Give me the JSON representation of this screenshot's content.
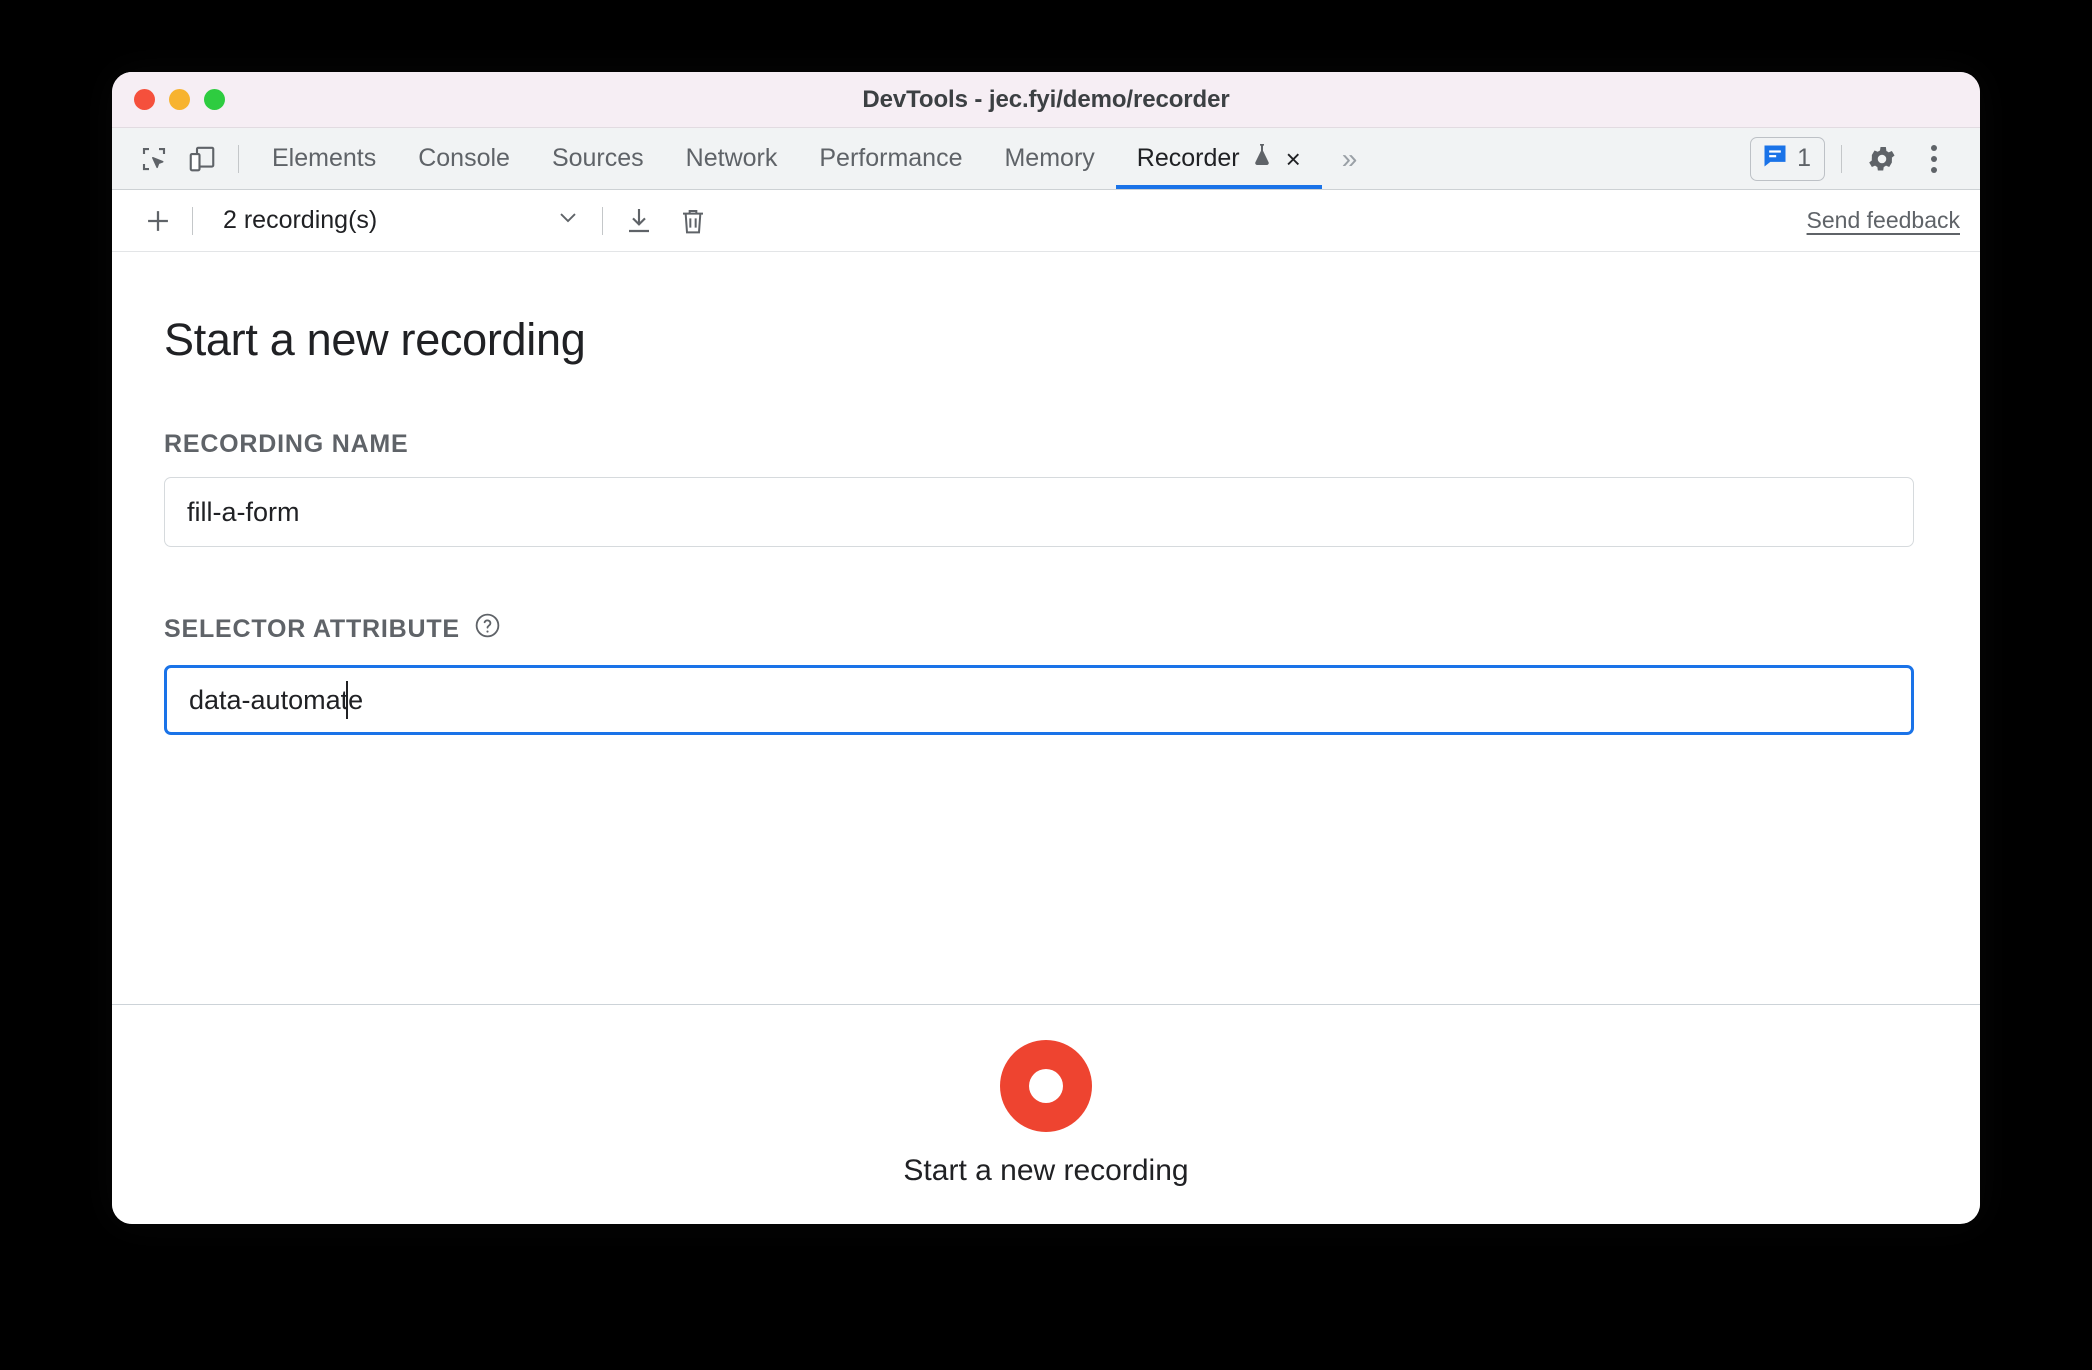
{
  "window": {
    "title": "DevTools - jec.fyi/demo/recorder",
    "traffic_lights": [
      "close",
      "minimize",
      "maximize"
    ]
  },
  "tabbar": {
    "left_icons": [
      {
        "name": "inspect-element-icon"
      },
      {
        "name": "device-toolbar-icon"
      }
    ],
    "tabs": [
      {
        "label": "Elements",
        "active": false
      },
      {
        "label": "Console",
        "active": false
      },
      {
        "label": "Sources",
        "active": false
      },
      {
        "label": "Network",
        "active": false
      },
      {
        "label": "Performance",
        "active": false
      },
      {
        "label": "Memory",
        "active": false
      },
      {
        "label": "Recorder",
        "active": true,
        "experimental": true,
        "closeable": true
      }
    ],
    "more_tabs_glyph": "»",
    "close_glyph": "×",
    "message_count": "1",
    "right_icons": [
      "console-message-icon",
      "settings-gear-icon",
      "more-options-icon"
    ],
    "accent_color": "#1a73e8"
  },
  "recorder_toolbar": {
    "add_label": "+",
    "recordings_label": "2 recording(s)",
    "dropdown_glyph": "∨",
    "icons": [
      "download-icon",
      "delete-icon"
    ],
    "feedback_label": "Send feedback"
  },
  "main": {
    "title": "Start a new recording",
    "fields": [
      {
        "label": "RECORDING NAME",
        "value": "fill-a-form",
        "placeholder": "Recording name",
        "focused": false,
        "help": false
      },
      {
        "label": "SELECTOR ATTRIBUTE",
        "value": "data-automate",
        "placeholder": "Selector attribute",
        "focused": true,
        "help": true,
        "help_glyph": "?"
      }
    ]
  },
  "footer": {
    "record_label": "Start a new recording",
    "record_color": "#ee4430"
  }
}
